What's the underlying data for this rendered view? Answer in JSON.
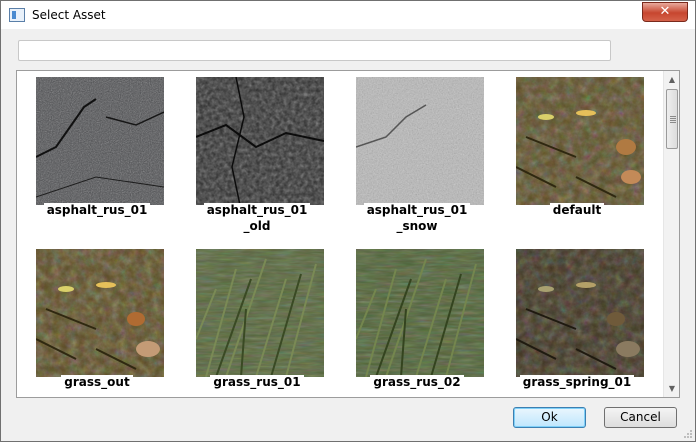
{
  "window": {
    "title": "Select Asset",
    "close_label": "✕"
  },
  "search": {
    "value": "",
    "placeholder": ""
  },
  "assets": [
    {
      "name": "asphalt_rus_01",
      "label_line1": "asphalt_rus_01",
      "label_line2": ""
    },
    {
      "name": "asphalt_rus_01_old",
      "label_line1": "asphalt_rus_01",
      "label_line2": "_old"
    },
    {
      "name": "asphalt_rus_01_snow",
      "label_line1": "asphalt_rus_01",
      "label_line2": "_snow"
    },
    {
      "name": "default",
      "label_line1": "default",
      "label_line2": ""
    },
    {
      "name": "grass_out",
      "label_line1": "grass_out",
      "label_line2": ""
    },
    {
      "name": "grass_rus_01",
      "label_line1": "grass_rus_01",
      "label_line2": ""
    },
    {
      "name": "grass_rus_02",
      "label_line1": "grass_rus_02",
      "label_line2": ""
    },
    {
      "name": "grass_spring_01",
      "label_line1": "grass_spring_01",
      "label_line2": ""
    }
  ],
  "buttons": {
    "ok": "Ok",
    "cancel": "Cancel"
  },
  "scrollbar": {
    "up_icon": "▲",
    "down_icon": "▼"
  }
}
